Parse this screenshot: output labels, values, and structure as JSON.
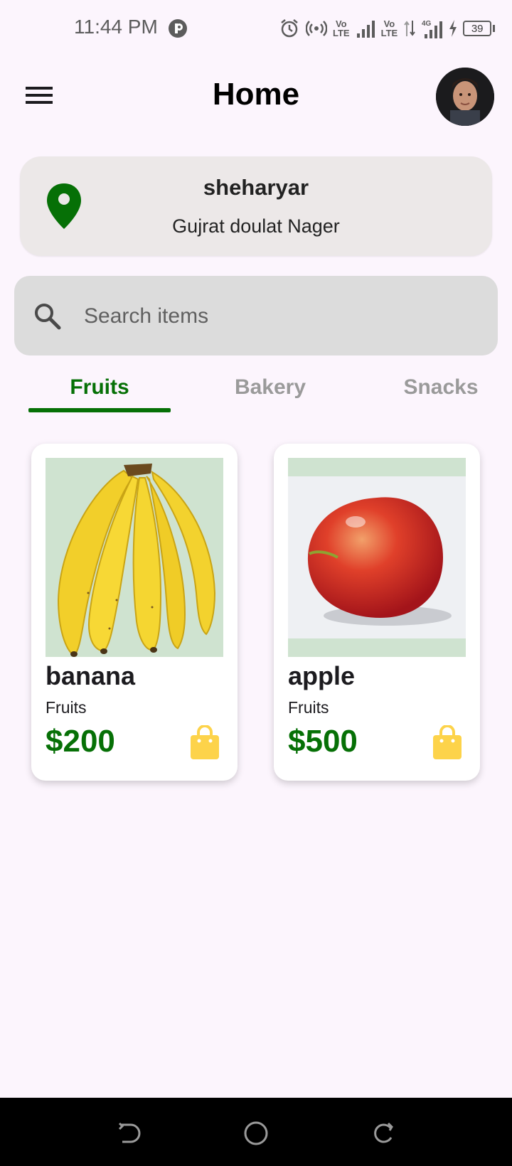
{
  "status_bar": {
    "time": "11:44 PM",
    "battery_level": "39",
    "network_label_1": "Vo\nLTE",
    "network_label_2": "Vo\nLTE",
    "network_type": "4G",
    "icons": [
      "app-p-icon",
      "alarm-icon",
      "hotspot-icon",
      "signal-icon",
      "signal-icon",
      "data-arrows-icon",
      "charging-icon",
      "battery-icon"
    ]
  },
  "app_bar": {
    "title": "Home",
    "menu_icon": "hamburger-menu-icon",
    "avatar": "profile-avatar"
  },
  "location": {
    "icon": "location-pin-icon",
    "name": "sheharyar",
    "address": "Gujrat doulat Nager",
    "color": "#067006"
  },
  "search": {
    "placeholder": "Search items",
    "value": "",
    "icon": "search-icon"
  },
  "tabs": [
    {
      "label": "Fruits",
      "active": true
    },
    {
      "label": "Bakery",
      "active": false
    },
    {
      "label": "Snacks",
      "active": false
    }
  ],
  "products": [
    {
      "name": "banana",
      "category": "Fruits",
      "price": "$200",
      "image": "banana-image",
      "cart_icon": "shopping-bag-icon"
    },
    {
      "name": "apple",
      "category": "Fruits",
      "price": "$500",
      "image": "apple-image",
      "cart_icon": "shopping-bag-icon"
    }
  ],
  "colors": {
    "accent_green": "#067006",
    "cart_yellow": "#fdd34a",
    "background": "#fcf5fd",
    "card_grey": "#ece8e8",
    "search_grey": "#dcdcdc"
  },
  "nav_bar": {
    "icons": [
      "back-icon",
      "home-circle-icon",
      "recents-icon"
    ]
  }
}
